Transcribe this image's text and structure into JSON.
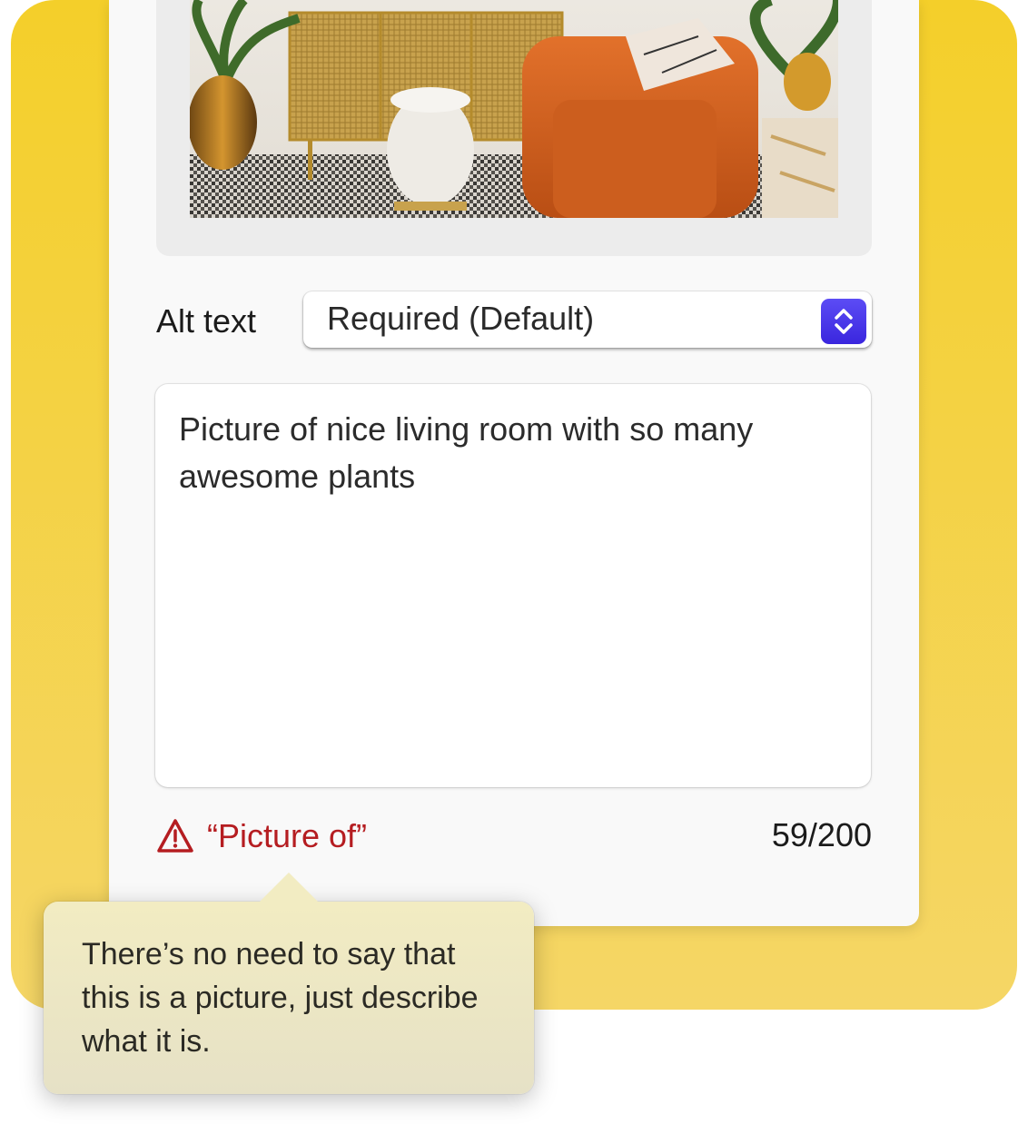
{
  "photo": {
    "alt": "living room with plants",
    "icon": "living-room-photo"
  },
  "alt_text": {
    "label": "Alt text",
    "select_value": "Required (Default)",
    "stepper_icon": "up-down-chevron-icon",
    "accent": "#4a36ec"
  },
  "textarea": {
    "value": "Picture of nice living room with so many awesome plants"
  },
  "validation": {
    "warning_icon": "warning-triangle-icon",
    "warning_text": "“Picture of”",
    "warning_color": "#b51d21",
    "counter": "59/200"
  },
  "tooltip": {
    "text": "There’s no need to say that this is a picture, just describe what it is."
  }
}
